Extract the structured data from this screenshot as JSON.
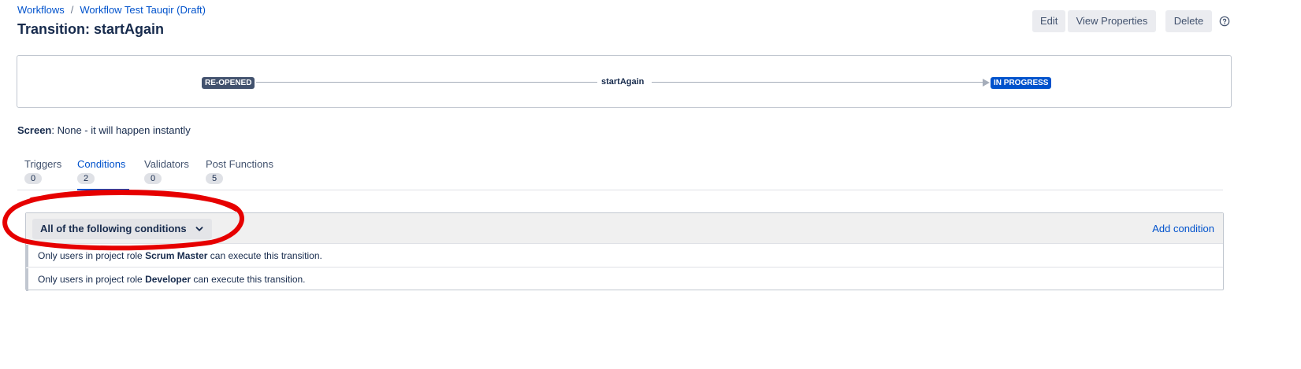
{
  "breadcrumb": {
    "items": [
      "Workflows",
      "Workflow Test Tauqir (Draft)"
    ],
    "separator": "/"
  },
  "page_title": "Transition: startAgain",
  "actions": {
    "edit": "Edit",
    "view_properties": "View Properties",
    "delete": "Delete",
    "help_icon": "help-icon"
  },
  "diagram": {
    "from_status": "RE-OPENED",
    "transition_name": "startAgain",
    "to_status": "IN PROGRESS",
    "from_color": "#42526e",
    "to_color": "#0052cc"
  },
  "screen": {
    "label": "Screen",
    "value": ": None - it will happen instantly"
  },
  "tabs": [
    {
      "label": "Triggers",
      "count": "0",
      "active": false
    },
    {
      "label": "Conditions",
      "count": "2",
      "active": true
    },
    {
      "label": "Validators",
      "count": "0",
      "active": false
    },
    {
      "label": "Post Functions",
      "count": "5",
      "active": false
    }
  ],
  "conditions": {
    "group_label": "All of the following conditions",
    "add_label": "Add condition",
    "rows": [
      {
        "prefix": "Only users in project role ",
        "role": "Scrum Master",
        "suffix": " can execute this transition."
      },
      {
        "prefix": "Only users in project role ",
        "role": "Developer",
        "suffix": " can execute this transition."
      }
    ]
  },
  "annotation_color": "#e60000"
}
